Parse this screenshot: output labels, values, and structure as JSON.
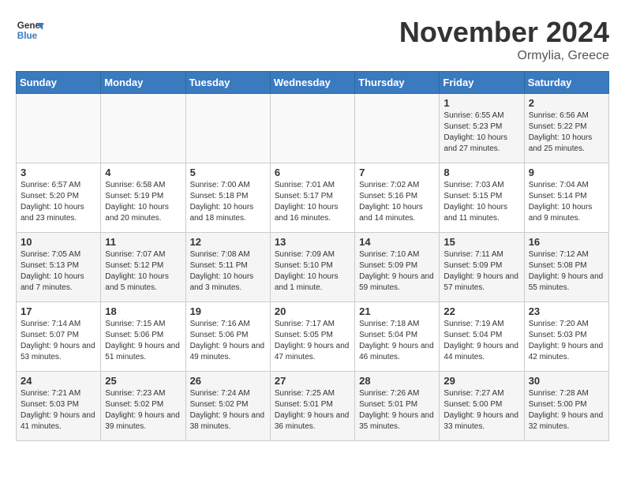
{
  "logo": {
    "line1": "General",
    "line2": "Blue"
  },
  "title": "November 2024",
  "subtitle": "Ormylia, Greece",
  "weekdays": [
    "Sunday",
    "Monday",
    "Tuesday",
    "Wednesday",
    "Thursday",
    "Friday",
    "Saturday"
  ],
  "weeks": [
    [
      {
        "day": "",
        "info": ""
      },
      {
        "day": "",
        "info": ""
      },
      {
        "day": "",
        "info": ""
      },
      {
        "day": "",
        "info": ""
      },
      {
        "day": "",
        "info": ""
      },
      {
        "day": "1",
        "info": "Sunrise: 6:55 AM\nSunset: 5:23 PM\nDaylight: 10 hours and 27 minutes."
      },
      {
        "day": "2",
        "info": "Sunrise: 6:56 AM\nSunset: 5:22 PM\nDaylight: 10 hours and 25 minutes."
      }
    ],
    [
      {
        "day": "3",
        "info": "Sunrise: 6:57 AM\nSunset: 5:20 PM\nDaylight: 10 hours and 23 minutes."
      },
      {
        "day": "4",
        "info": "Sunrise: 6:58 AM\nSunset: 5:19 PM\nDaylight: 10 hours and 20 minutes."
      },
      {
        "day": "5",
        "info": "Sunrise: 7:00 AM\nSunset: 5:18 PM\nDaylight: 10 hours and 18 minutes."
      },
      {
        "day": "6",
        "info": "Sunrise: 7:01 AM\nSunset: 5:17 PM\nDaylight: 10 hours and 16 minutes."
      },
      {
        "day": "7",
        "info": "Sunrise: 7:02 AM\nSunset: 5:16 PM\nDaylight: 10 hours and 14 minutes."
      },
      {
        "day": "8",
        "info": "Sunrise: 7:03 AM\nSunset: 5:15 PM\nDaylight: 10 hours and 11 minutes."
      },
      {
        "day": "9",
        "info": "Sunrise: 7:04 AM\nSunset: 5:14 PM\nDaylight: 10 hours and 9 minutes."
      }
    ],
    [
      {
        "day": "10",
        "info": "Sunrise: 7:05 AM\nSunset: 5:13 PM\nDaylight: 10 hours and 7 minutes."
      },
      {
        "day": "11",
        "info": "Sunrise: 7:07 AM\nSunset: 5:12 PM\nDaylight: 10 hours and 5 minutes."
      },
      {
        "day": "12",
        "info": "Sunrise: 7:08 AM\nSunset: 5:11 PM\nDaylight: 10 hours and 3 minutes."
      },
      {
        "day": "13",
        "info": "Sunrise: 7:09 AM\nSunset: 5:10 PM\nDaylight: 10 hours and 1 minute."
      },
      {
        "day": "14",
        "info": "Sunrise: 7:10 AM\nSunset: 5:09 PM\nDaylight: 9 hours and 59 minutes."
      },
      {
        "day": "15",
        "info": "Sunrise: 7:11 AM\nSunset: 5:09 PM\nDaylight: 9 hours and 57 minutes."
      },
      {
        "day": "16",
        "info": "Sunrise: 7:12 AM\nSunset: 5:08 PM\nDaylight: 9 hours and 55 minutes."
      }
    ],
    [
      {
        "day": "17",
        "info": "Sunrise: 7:14 AM\nSunset: 5:07 PM\nDaylight: 9 hours and 53 minutes."
      },
      {
        "day": "18",
        "info": "Sunrise: 7:15 AM\nSunset: 5:06 PM\nDaylight: 9 hours and 51 minutes."
      },
      {
        "day": "19",
        "info": "Sunrise: 7:16 AM\nSunset: 5:06 PM\nDaylight: 9 hours and 49 minutes."
      },
      {
        "day": "20",
        "info": "Sunrise: 7:17 AM\nSunset: 5:05 PM\nDaylight: 9 hours and 47 minutes."
      },
      {
        "day": "21",
        "info": "Sunrise: 7:18 AM\nSunset: 5:04 PM\nDaylight: 9 hours and 46 minutes."
      },
      {
        "day": "22",
        "info": "Sunrise: 7:19 AM\nSunset: 5:04 PM\nDaylight: 9 hours and 44 minutes."
      },
      {
        "day": "23",
        "info": "Sunrise: 7:20 AM\nSunset: 5:03 PM\nDaylight: 9 hours and 42 minutes."
      }
    ],
    [
      {
        "day": "24",
        "info": "Sunrise: 7:21 AM\nSunset: 5:03 PM\nDaylight: 9 hours and 41 minutes."
      },
      {
        "day": "25",
        "info": "Sunrise: 7:23 AM\nSunset: 5:02 PM\nDaylight: 9 hours and 39 minutes."
      },
      {
        "day": "26",
        "info": "Sunrise: 7:24 AM\nSunset: 5:02 PM\nDaylight: 9 hours and 38 minutes."
      },
      {
        "day": "27",
        "info": "Sunrise: 7:25 AM\nSunset: 5:01 PM\nDaylight: 9 hours and 36 minutes."
      },
      {
        "day": "28",
        "info": "Sunrise: 7:26 AM\nSunset: 5:01 PM\nDaylight: 9 hours and 35 minutes."
      },
      {
        "day": "29",
        "info": "Sunrise: 7:27 AM\nSunset: 5:00 PM\nDaylight: 9 hours and 33 minutes."
      },
      {
        "day": "30",
        "info": "Sunrise: 7:28 AM\nSunset: 5:00 PM\nDaylight: 9 hours and 32 minutes."
      }
    ]
  ]
}
